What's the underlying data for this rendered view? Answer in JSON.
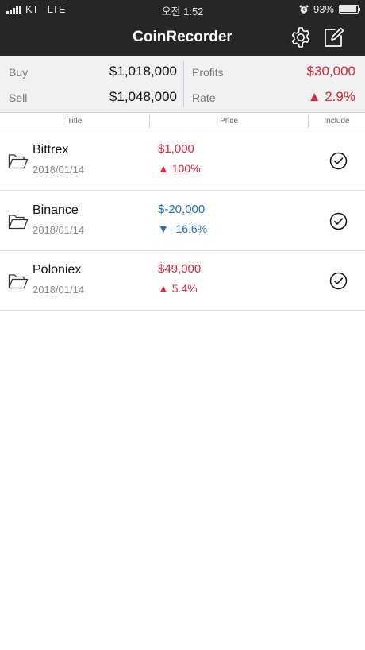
{
  "status_bar": {
    "carrier": "KT",
    "network": "LTE",
    "time": "오전 1:52",
    "battery": "93%",
    "battery_level": 0.93
  },
  "nav": {
    "title": "CoinRecorder",
    "settings_icon": "gear-icon",
    "compose_icon": "compose-icon"
  },
  "summary": {
    "buy_label": "Buy",
    "buy_value": "$1,018,000",
    "sell_label": "Sell",
    "sell_value": "$1,048,000",
    "profits_label": "Profits",
    "profits_value": "$30,000",
    "rate_label": "Rate",
    "rate_value": "▲ 2.9%"
  },
  "columns": {
    "title": "Title",
    "price": "Price",
    "include": "Include"
  },
  "colors": {
    "up": "#d9263a",
    "down": "#1f6fb6",
    "nav_bg": "#262626"
  },
  "exchanges": [
    {
      "name": "Bittrex",
      "date": "2018/01/14",
      "price": "$1,000",
      "rate": "▲ 100%",
      "trend": "up",
      "included": true
    },
    {
      "name": "Binance",
      "date": "2018/01/14",
      "price": "$-20,000",
      "rate": "▼ -16.6%",
      "trend": "down",
      "included": true
    },
    {
      "name": "Poloniex",
      "date": "2018/01/14",
      "price": "$49,000",
      "rate": "▲ 5.4%",
      "trend": "up",
      "included": true
    }
  ]
}
